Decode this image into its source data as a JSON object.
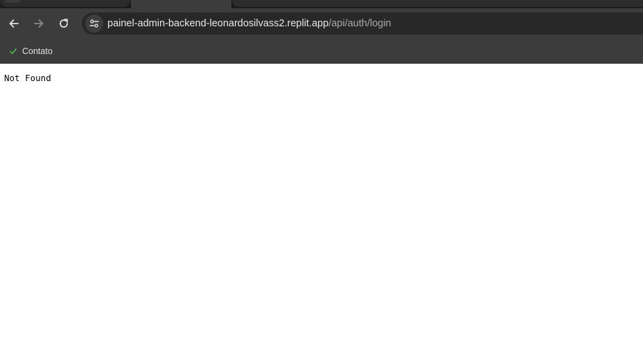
{
  "browser": {
    "url": {
      "host": "painel-admin-backend-leonardosilvass2.replit.app",
      "path": "/api/auth/login"
    },
    "bookmarks": [
      {
        "label": "Contato",
        "icon": "checkmark-icon",
        "icon_color": "#4caf50"
      }
    ],
    "colors": {
      "toolbar": "#3c3c3c",
      "omnibox": "#282828",
      "tabstrip": "#1b1b1b"
    }
  },
  "page": {
    "body_text": "Not Found"
  }
}
